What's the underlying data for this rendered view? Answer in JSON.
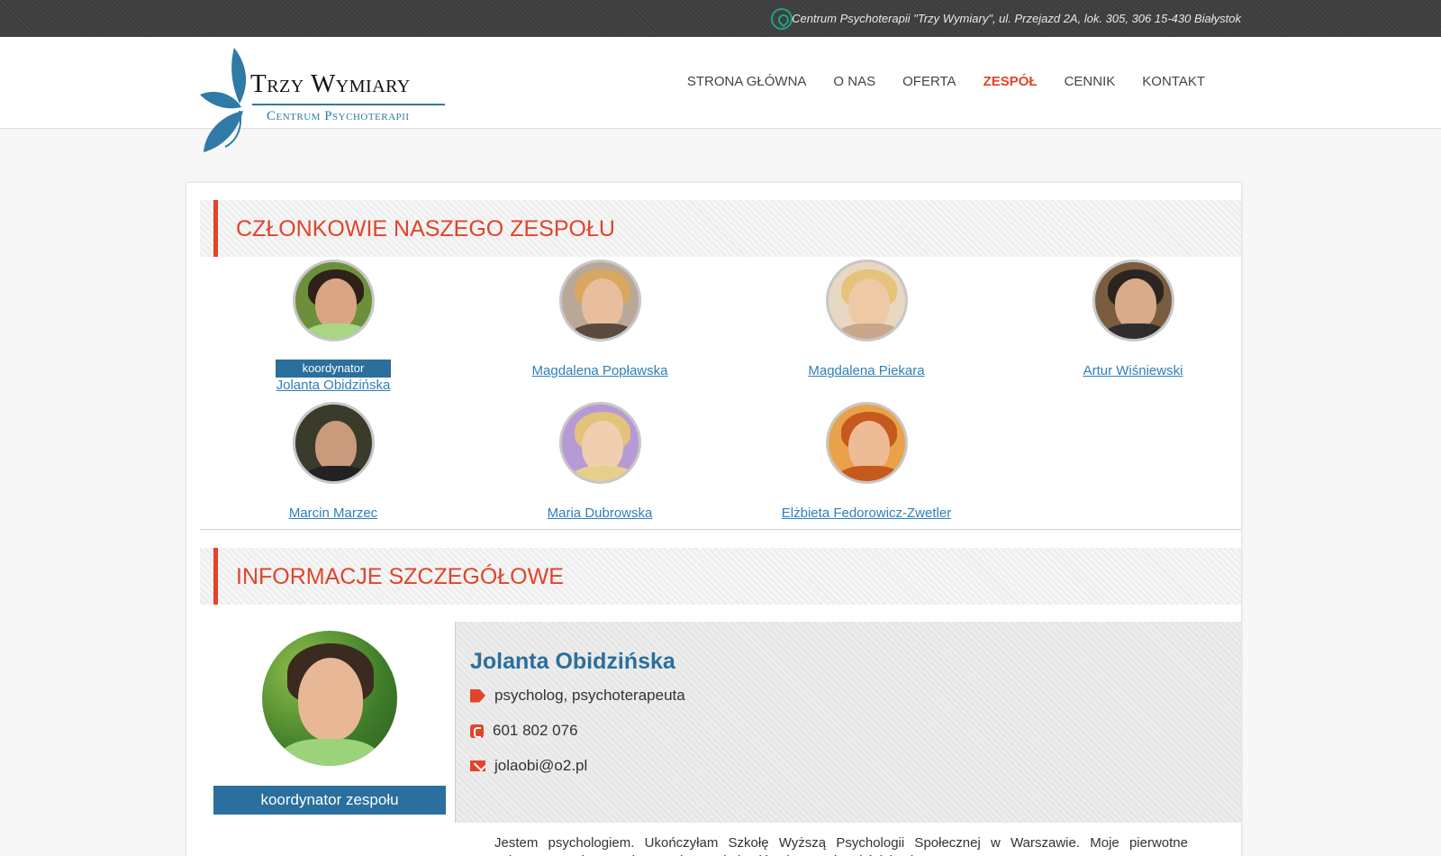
{
  "topbar": {
    "address": "Centrum Psychoterapii \"Trzy Wymiary\", ul. Przejazd 2A, lok. 305, 306 15-430 Białystok",
    "icon": "location-pin-icon"
  },
  "logo": {
    "brand": "Trzy Wymiary",
    "subtitle": "Centrum Psychoterapii"
  },
  "nav": {
    "items": [
      {
        "label": "STRONA GŁÓWNA",
        "active": false
      },
      {
        "label": "O NAS",
        "active": false
      },
      {
        "label": "OFERTA",
        "active": false
      },
      {
        "label": "ZESPÓŁ",
        "active": true
      },
      {
        "label": "CENNIK",
        "active": false
      },
      {
        "label": "KONTAKT",
        "active": false
      }
    ]
  },
  "members_section": {
    "title": "CZŁONKOWIE NASZEGO ZESPOŁU",
    "members": [
      {
        "name": "Jolanta Obidzińska",
        "badge": "koordynator"
      },
      {
        "name": "Magdalena Popławska"
      },
      {
        "name": "Magdalena Piekara"
      },
      {
        "name": "Artur Wiśniewski"
      },
      {
        "name": "Marcin Marzec"
      },
      {
        "name": "Maria Dubrowska"
      },
      {
        "name": "Elżbieta Fedorowicz-Zwetler"
      }
    ]
  },
  "details_section": {
    "title": "INFORMACJE SZCZEGÓŁOWE",
    "coordinator_label": "koordynator zespołu",
    "name": "Jolanta Obidzińska",
    "profession": "psycholog, psychoterapeuta",
    "phone": "601 802 076",
    "email": "jolaobi@o2.pl",
    "bio": "Jestem psychologiem. Ukończyłam Szkołę Wyższą Psychologii Społecznej w Warszawie. Moje pierwotne zainteresowania zawodowe związane były głównie z naukami ścisłymi."
  },
  "colors": {
    "accent": "#e1442b",
    "link": "#2f7fb8",
    "badge": "#2a6f9d"
  }
}
